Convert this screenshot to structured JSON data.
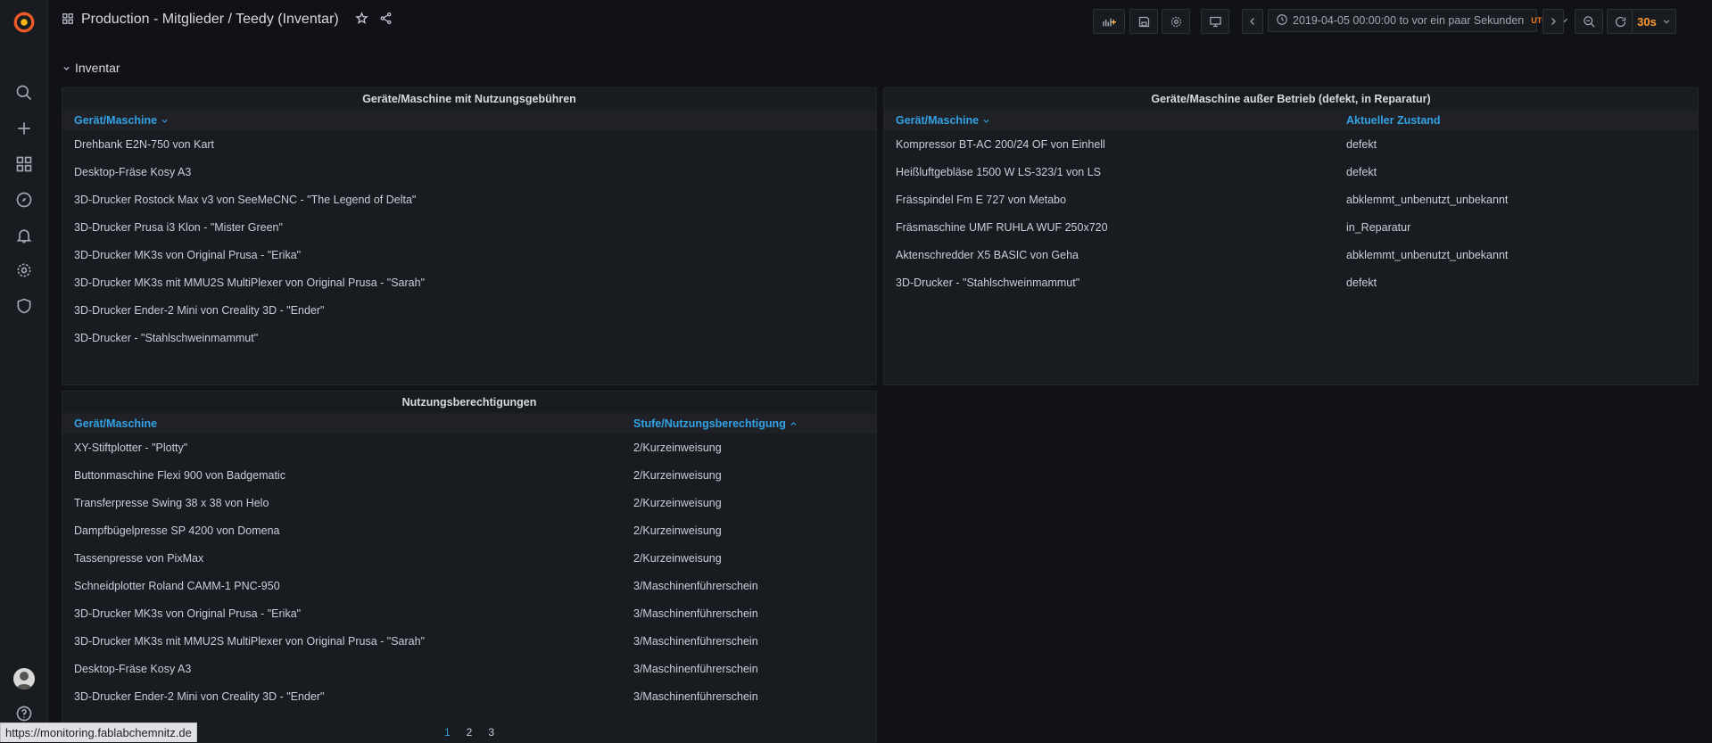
{
  "header": {
    "title": "Production - Mitglieder / Teedy (Inventar)",
    "time_range": "2019-04-05 00:00:00 to vor ein paar Sekunden",
    "timezone": "UTC",
    "refresh": "30s"
  },
  "row": {
    "title": "Inventar"
  },
  "panels": {
    "fees": {
      "title": "Geräte/Maschine mit Nutzungsgebühren",
      "columns": [
        "Gerät/Maschine"
      ],
      "rows": [
        [
          "Drehbank E2N-750 von Kart"
        ],
        [
          "Desktop-Fräse Kosy A3"
        ],
        [
          "3D-Drucker Rostock Max v3 von SeeMeCNC - \"The Legend of Delta\""
        ],
        [
          "3D-Drucker Prusa i3 Klon - \"Mister Green\""
        ],
        [
          "3D-Drucker MK3s von Original Prusa - \"Erika\""
        ],
        [
          "3D-Drucker MK3s mit MMU2S MultiPlexer von Original Prusa - \"Sarah\""
        ],
        [
          "3D-Drucker Ender-2 Mini von Creality 3D - \"Ender\""
        ],
        [
          "3D-Drucker - \"Stahlschweinmammut\""
        ]
      ]
    },
    "out_of_service": {
      "title": "Geräte/Maschine außer Betrieb (defekt, in Reparatur)",
      "columns": [
        "Gerät/Maschine",
        "Aktueller Zustand"
      ],
      "rows": [
        [
          "Kompressor BT-AC 200/24 OF von Einhell",
          "defekt"
        ],
        [
          "Heißluftgebläse 1500 W LS-323/1 von LS",
          "defekt"
        ],
        [
          "Frässpindel Fm E 727 von Metabo",
          "abklemmt_unbenutzt_unbekannt"
        ],
        [
          "Fräsmaschine UMF RUHLA WUF 250x720",
          "in_Reparatur"
        ],
        [
          "Aktenschredder X5 BASIC von Geha",
          "abklemmt_unbenutzt_unbekannt"
        ],
        [
          "3D-Drucker - \"Stahlschweinmammut\"",
          "defekt"
        ]
      ]
    },
    "permissions": {
      "title": "Nutzungsberechtigungen",
      "columns": [
        "Gerät/Maschine",
        "Stufe/Nutzungsberechtigung"
      ],
      "rows": [
        [
          "XY-Stiftplotter - \"Plotty\"",
          "2/Kurzeinweisung"
        ],
        [
          "Buttonmaschine Flexi 900 von Badgematic",
          "2/Kurzeinweisung"
        ],
        [
          "Transferpresse Swing 38 x 38 von Helo",
          "2/Kurzeinweisung"
        ],
        [
          "Dampfbügelpresse SP 4200 von Domena",
          "2/Kurzeinweisung"
        ],
        [
          "Tassenpresse von PixMax",
          "2/Kurzeinweisung"
        ],
        [
          "Schneidplotter Roland CAMM-1 PNC-950",
          "3/Maschinenführerschein"
        ],
        [
          "3D-Drucker MK3s von Original Prusa - \"Erika\"",
          "3/Maschinenführerschein"
        ],
        [
          "3D-Drucker MK3s mit MMU2S MultiPlexer von Original Prusa - \"Sarah\"",
          "3/Maschinenführerschein"
        ],
        [
          "Desktop-Fräse Kosy A3",
          "3/Maschinenführerschein"
        ],
        [
          "3D-Drucker Ender-2 Mini von Creality 3D - \"Ender\"",
          "3/Maschinenführerschein"
        ]
      ],
      "pages": [
        "1",
        "2",
        "3"
      ],
      "current_page": "1"
    }
  },
  "status_bar": {
    "url": "https://monitoring.fablabchemnitz.de"
  },
  "colors": {
    "accent": "#33a2e5",
    "brand": "#f05a28",
    "refresh": "#ff9830"
  }
}
